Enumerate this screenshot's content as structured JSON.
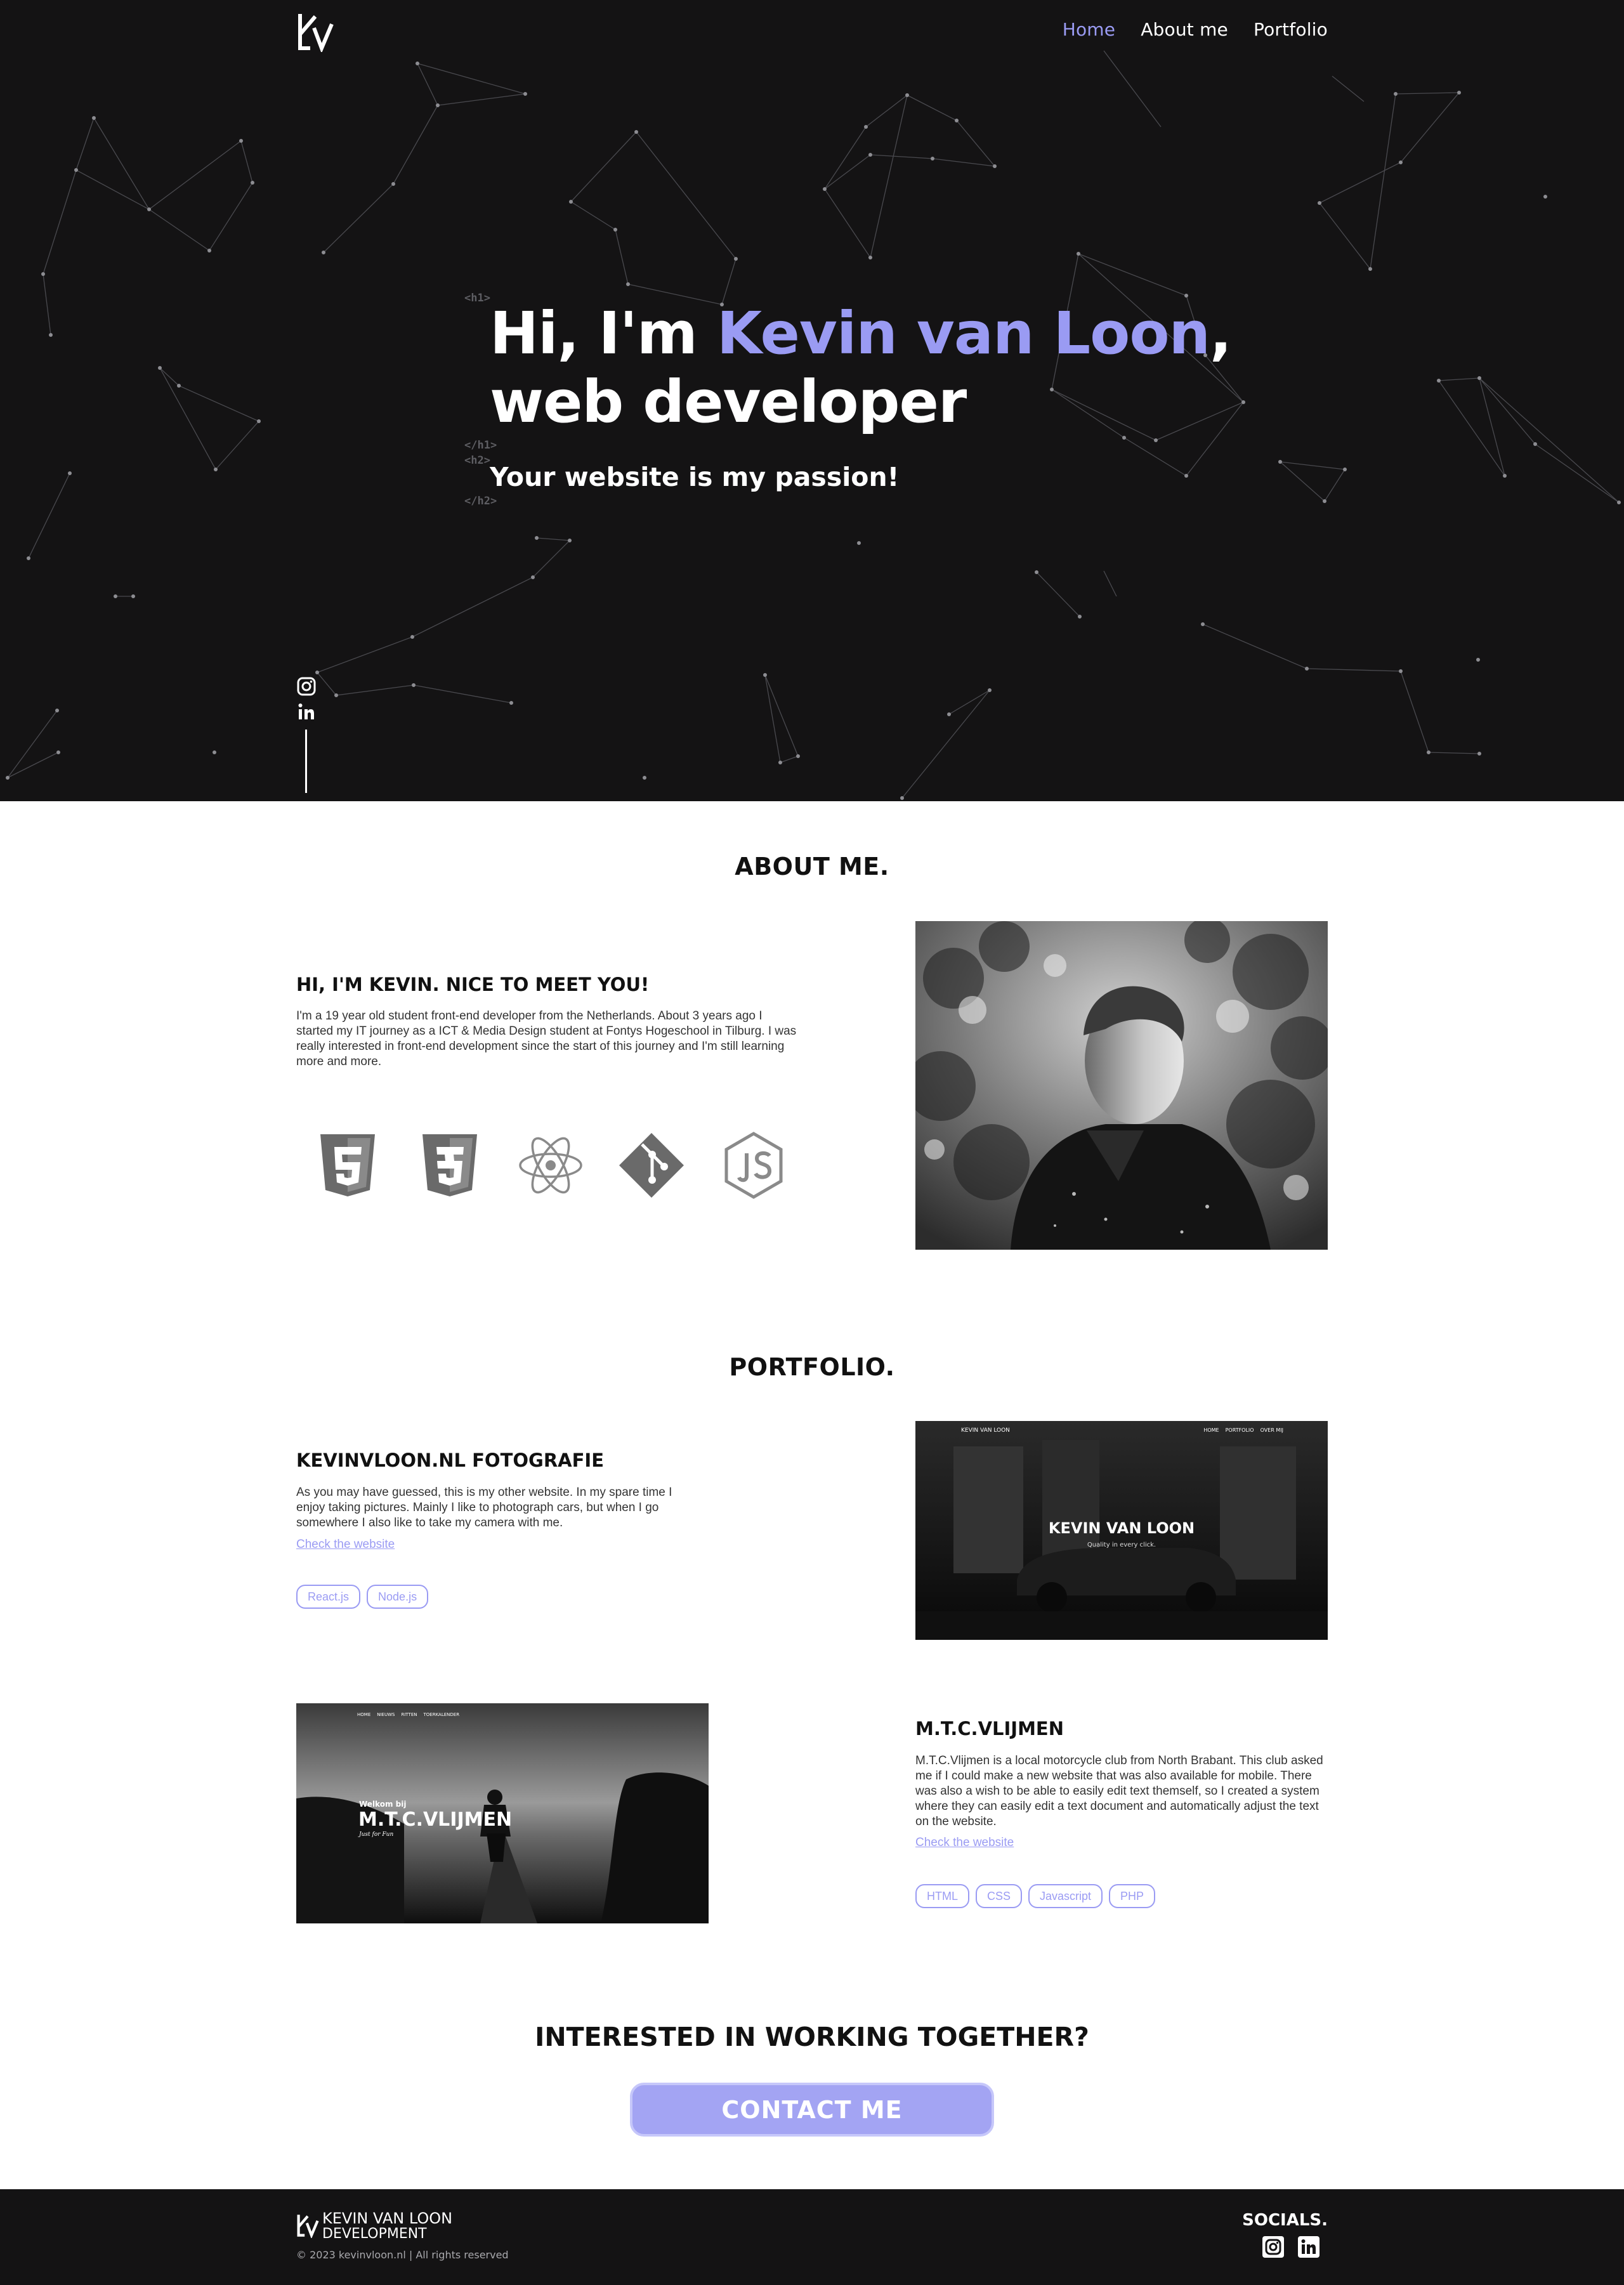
{
  "nav": {
    "items": [
      "Home",
      "About me",
      "Portfolio"
    ],
    "active": "Home"
  },
  "hero": {
    "tags": {
      "h1_open": "<h1>",
      "h1_close": "</h1>",
      "h2_open": "<h2>",
      "h2_close": "</h2>"
    },
    "title_prefix": "Hi, I'm ",
    "title_name": "Kevin van Loon",
    "title_comma": ",",
    "title_line2": "web developer",
    "subtitle": "Your website is my passion!",
    "socials": [
      "instagram-icon",
      "linkedin-icon"
    ]
  },
  "about": {
    "section_title": "ABOUT ME.",
    "heading": "HI, I'M KEVIN. NICE TO MEET YOU!",
    "text": "I'm a 19 year old student front-end developer from the Netherlands. About 3 years ago I started my IT journey as a ICT & Media Design student at Fontys Hogeschool in Tilburg. I was really interested in front-end development since the start of this journey and I'm still learning more and more.",
    "tech_icons": [
      "html5-icon",
      "css3-icon",
      "react-icon",
      "git-icon",
      "nodejs-icon"
    ]
  },
  "portfolio": {
    "section_title": "PORTFOLIO.",
    "projects": [
      {
        "title": "KEVINVLOON.NL FOTOGRAFIE",
        "text": "As you may have guessed, this is my other website. In my spare time I enjoy taking pictures. Mainly I like to photograph cars, but when I go somewhere I also like to take my camera with me.",
        "link": "Check the website",
        "tags": [
          "React.js",
          "Node.js"
        ],
        "preview": {
          "nav": [
            "HOME",
            "PORTFOLIO",
            "OVER MIJ"
          ],
          "logo": "KEVIN VAN LOON",
          "headline": "KEVIN VAN LOON",
          "tagline": "Quality in every click."
        }
      },
      {
        "title": "M.T.C.VLIJMEN",
        "text": "M.T.C.Vlijmen is a local motorcycle club from North Brabant. This club asked me if I could make a new website that was also available for mobile. There was also a wish to be able to easily edit text themself, so I created a system where they can easily edit a text document and automatically adjust the text on the website.",
        "link": "Check the website",
        "tags": [
          "HTML",
          "CSS",
          "Javascript",
          "PHP"
        ],
        "preview": {
          "nav": [
            "HOME",
            "NIEUWS",
            "RITTEN",
            "TOERKALENDER"
          ],
          "welcome": "Welkom bij",
          "headline": "M.T.C.VLIJMEN",
          "tagline": "Just for Fun"
        }
      }
    ]
  },
  "cta": {
    "title": "INTERESTED IN WORKING TOGETHER?",
    "button": "CONTACT ME"
  },
  "footer": {
    "brand_line1": "KEVIN VAN LOON",
    "brand_line2": "DEVELOPMENT",
    "copyright": "© 2023 kevinvloon.nl | All rights reserved",
    "socials_title": "SOCIALS.",
    "socials": [
      "instagram-icon",
      "linkedin-icon"
    ]
  },
  "colors": {
    "accent": "#9a9bf3",
    "dark": "#141314",
    "button": "#a3a4f3"
  }
}
